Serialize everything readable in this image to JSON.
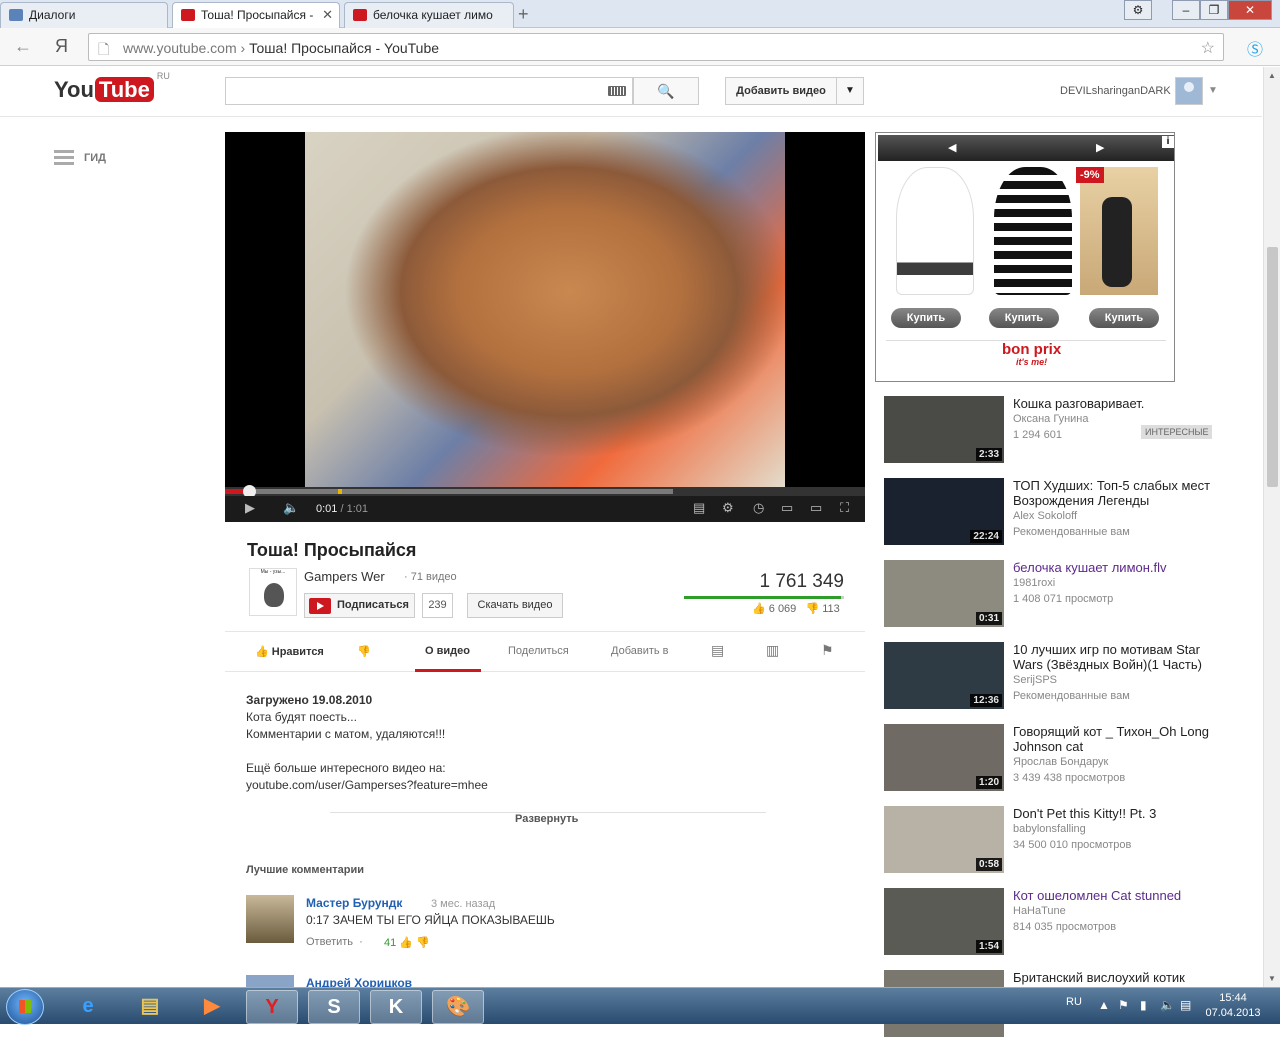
{
  "browser": {
    "tabs": [
      {
        "label": "Диалоги",
        "active": false
      },
      {
        "label": "Тоша! Просыпайся -",
        "active": true
      },
      {
        "label": "белочка кушает лимо",
        "active": false
      }
    ],
    "new_tab": "+",
    "url_domain": "www.youtube.com",
    "url_sep": "›",
    "url_page": "Тоша! Просыпайся - YouTube",
    "yandex_icon": "Я"
  },
  "header": {
    "logo_you": "You",
    "logo_tube": "Tube",
    "logo_region": "RU",
    "search_placeholder": "",
    "upload_label": "Добавить видео",
    "username": "DEVILsharinganDARK"
  },
  "guide": {
    "label": "ГИД"
  },
  "player": {
    "current_time": "0:01",
    "duration": "/ 1:01",
    "progress_fraction": 0.016
  },
  "video": {
    "title": "Тоша! Просыпайся",
    "channel_name": "Gampers Wer",
    "channel_video_count": "· 71 видео",
    "channel_thumb_text": "Мы - узы...",
    "subscribe_label": "Подписаться",
    "subscriber_count": "239",
    "download_label": "Скачать видео",
    "view_count": "1 761 349",
    "likes": "6 069",
    "dislikes": "113",
    "like_ratio": 0.982
  },
  "actions": {
    "like": "Нравится",
    "about": "О видео",
    "share": "Поделиться",
    "add_to": "Добавить в"
  },
  "description": {
    "uploaded": "Загружено 19.08.2010",
    "line1": "Кота будят поесть...",
    "line2": "Комментарии с матом, удаляются!!!",
    "line3": "Ещё больше интересного видео на:",
    "line4": "youtube.com/user/Gamperses?feature=mhee",
    "expand": "Развернуть"
  },
  "comments": {
    "title": "Лучшие комментарии",
    "items": [
      {
        "author": "Мастер Бурундк",
        "when": "3 мес. назад",
        "text": "0:17 ЗАЧЕМ ТЫ ЕГО ЯЙЦА ПОКАЗЫВАЕШЬ",
        "reply": "Ответить",
        "likes": "41"
      }
    ],
    "next_author": "Андрей Хорицков"
  },
  "ad": {
    "discount": "-9%",
    "buy": "Купить",
    "brand": "bon prix",
    "brand_tag": "it's me!"
  },
  "related": [
    {
      "title": "Кошка разговаривает.",
      "author": "Оксана Гунина",
      "meta": "1 294 601",
      "badge": "ИНТЕРЕСНЫЕ",
      "duration": "2:33",
      "visited": false
    },
    {
      "title": "ТОП Худших: Топ-5 слабых мест Возрождения Легенды",
      "author": "Alex Sokoloff",
      "meta": "Рекомендованные вам",
      "duration": "22:24",
      "visited": false
    },
    {
      "title": "белочка кушает лимон.flv",
      "author": "1981roxi",
      "meta": "1 408 071 просмотр",
      "duration": "0:31",
      "visited": true
    },
    {
      "title": "10 лучших игр по мотивам Star Wars (Звёздных Войн)(1 Часть)",
      "author": "SerijSPS",
      "meta": "Рекомендованные вам",
      "duration": "12:36",
      "visited": false
    },
    {
      "title": "Говорящий кот _ Тихон_Oh Long Johnson cat",
      "author": "Ярослав Бондарук",
      "meta": "3 439 438 просмотров",
      "duration": "1:20",
      "visited": false
    },
    {
      "title": "Don't Pet this Kitty!! Pt. 3",
      "author": "babylonsfalling",
      "meta": "34 500 010 просмотров",
      "duration": "0:58",
      "visited": false
    },
    {
      "title": "Кот ошеломлен Cat stunned",
      "author": "HaHaTune",
      "meta": "814 035 просмотров",
      "duration": "1:54",
      "visited": true
    },
    {
      "title": "Британский вислоухий котик",
      "author": "",
      "meta": "",
      "duration": "",
      "visited": false
    }
  ],
  "taskbar": {
    "lang": "RU",
    "time": "15:44",
    "date": "07.04.2013"
  }
}
